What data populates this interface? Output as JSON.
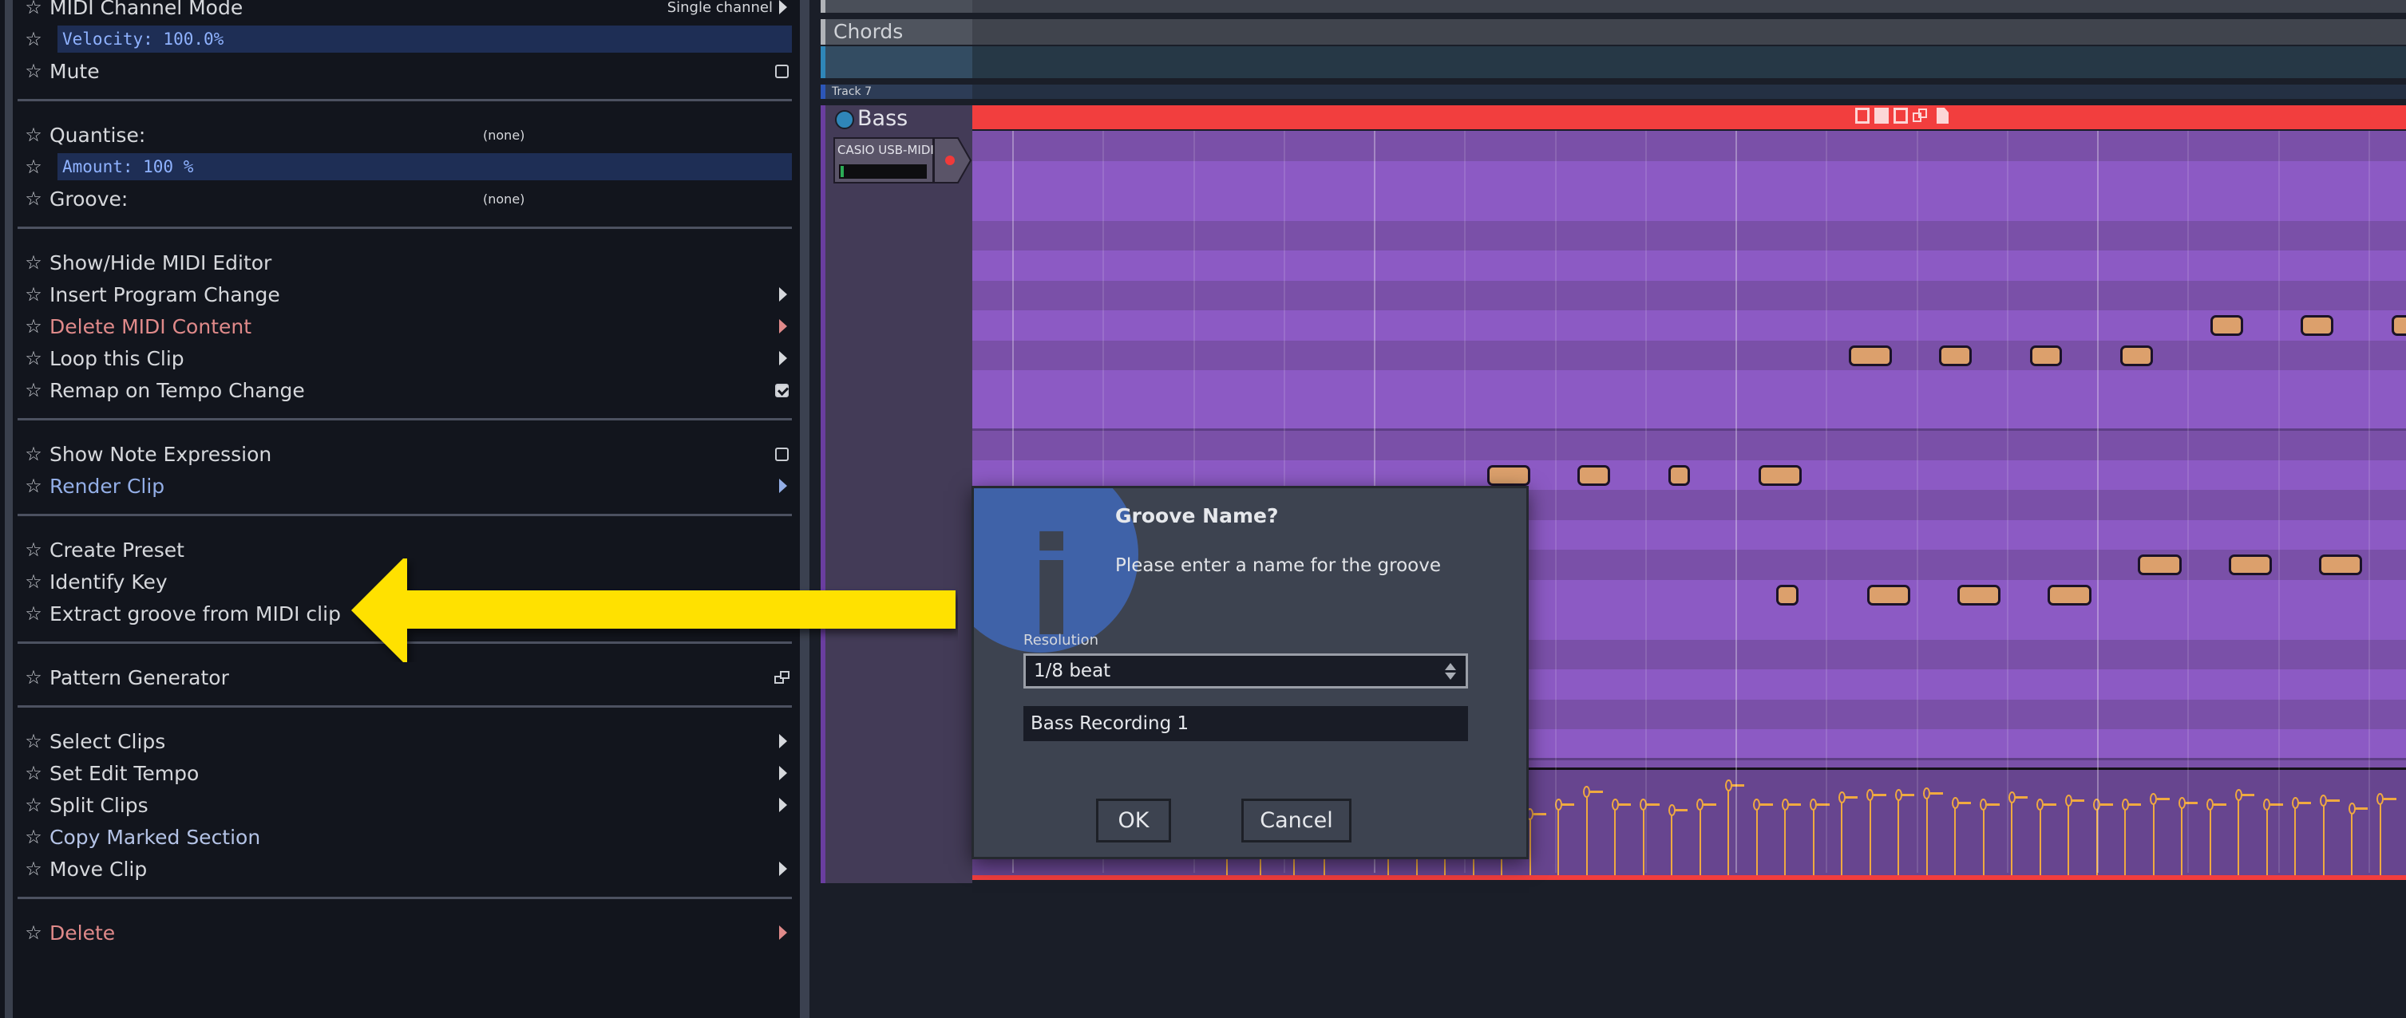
{
  "context_menu": {
    "items": [
      {
        "label": "MIDI Channel Mode",
        "value": "Single channel",
        "right": "submenu",
        "style": "normal"
      },
      {
        "label": "Velocity: 100.0%",
        "style": "slider"
      },
      {
        "label": "Mute",
        "right": "checkbox",
        "checked": false,
        "style": "normal"
      },
      {
        "label": "Quantise:",
        "value": "(none)",
        "style": "normal"
      },
      {
        "label": "Amount: 100 %",
        "style": "slider"
      },
      {
        "label": "Groove:",
        "value": "(none)",
        "style": "normal"
      },
      {
        "label": "Show/Hide MIDI Editor",
        "style": "normal"
      },
      {
        "label": "Insert Program Change",
        "right": "submenu",
        "style": "normal"
      },
      {
        "label": "Delete MIDI Content",
        "right": "submenu",
        "style": "red"
      },
      {
        "label": "Loop this Clip",
        "right": "submenu",
        "style": "normal"
      },
      {
        "label": "Remap on Tempo Change",
        "right": "checkbox",
        "checked": true,
        "style": "normal"
      },
      {
        "label": "Show Note Expression",
        "right": "checkbox",
        "checked": false,
        "style": "normal"
      },
      {
        "label": "Render Clip",
        "right": "submenu",
        "style": "blue"
      },
      {
        "label": "Create Preset",
        "style": "normal"
      },
      {
        "label": "Identify Key",
        "style": "normal"
      },
      {
        "label": "Extract groove from MIDI clip",
        "style": "normal"
      },
      {
        "label": "Pattern Generator",
        "right": "popout",
        "style": "normal"
      },
      {
        "label": "Select Clips",
        "right": "submenu",
        "style": "normal"
      },
      {
        "label": "Set Edit Tempo",
        "right": "submenu",
        "style": "normal"
      },
      {
        "label": "Split Clips",
        "right": "submenu",
        "style": "normal"
      },
      {
        "label": "Copy Marked Section",
        "style": "paleblue"
      },
      {
        "label": "Move Clip",
        "right": "submenu",
        "style": "normal"
      },
      {
        "label": "Delete",
        "right": "submenu",
        "style": "red"
      }
    ]
  },
  "tracks": {
    "chords": {
      "name": "Chords"
    },
    "track7": {
      "name": "Track 7"
    },
    "bass": {
      "name": "Bass",
      "input_device": "CASIO USB-MIDI",
      "record_armed": true
    }
  },
  "colors": {
    "clip_header": "#f23e3e",
    "midi_clip": "#8c5ac4",
    "note": "#dca06c",
    "velocity": "#f0a940",
    "annotation_arrow": "#ffe100",
    "dialog_icon": "#3f62a8"
  },
  "clip_toolbar_icons": [
    "square-outline-icon",
    "square-filled-icon",
    "corner-icon",
    "link-icon",
    "file-icon"
  ],
  "dialog": {
    "title": "Groove Name?",
    "message": "Please enter a name for the groove",
    "resolution_label": "Resolution",
    "resolution_value": "1/8 beat",
    "name_value": "Bass Recording 1",
    "ok_label": "OK",
    "cancel_label": "Cancel",
    "icon": "info-icon"
  },
  "annotation": {
    "type": "arrow",
    "points_to": "Extract groove from MIDI clip"
  },
  "piano_roll": {
    "notes": [
      {
        "beat": 1.7,
        "pitch_row": 11,
        "len": 0.2
      },
      {
        "beat": 2.2,
        "pitch_row": 11,
        "len": 0.15
      },
      {
        "beat": 2.7,
        "pitch_row": 11,
        "len": 0.1
      },
      {
        "beat": 3.2,
        "pitch_row": 11,
        "len": 0.2
      },
      {
        "beat": 3.7,
        "pitch_row": 7,
        "len": 0.2
      },
      {
        "beat": 4.2,
        "pitch_row": 7,
        "len": 0.15
      },
      {
        "beat": 4.7,
        "pitch_row": 7,
        "len": 0.15
      },
      {
        "beat": 5.2,
        "pitch_row": 7,
        "len": 0.15
      },
      {
        "beat": 5.7,
        "pitch_row": 6,
        "len": 0.15
      },
      {
        "beat": 6.2,
        "pitch_row": 6,
        "len": 0.15
      },
      {
        "beat": 6.7,
        "pitch_row": 6,
        "len": 0.1
      },
      {
        "beat": 1.05,
        "pitch_row": 16,
        "len": 0.2
      },
      {
        "beat": 1.55,
        "pitch_row": 16,
        "len": 0.2
      },
      {
        "beat": 1.05,
        "pitch_row": 15,
        "len": 0.2
      },
      {
        "beat": 3.3,
        "pitch_row": 15,
        "len": 0.1
      },
      {
        "beat": 3.8,
        "pitch_row": 15,
        "len": 0.2
      },
      {
        "beat": 4.3,
        "pitch_row": 15,
        "len": 0.2
      },
      {
        "beat": 4.8,
        "pitch_row": 15,
        "len": 0.2
      },
      {
        "beat": 5.3,
        "pitch_row": 14,
        "len": 0.2
      },
      {
        "beat": 5.8,
        "pitch_row": 14,
        "len": 0.2
      },
      {
        "beat": 6.3,
        "pitch_row": 14,
        "len": 0.2
      },
      {
        "beat": 6.85,
        "pitch_row": 14,
        "len": 0.2
      },
      {
        "beat": 0.3,
        "pitch_row": 17,
        "len": 0.2
      },
      {
        "beat": 0.8,
        "pitch_row": 17,
        "len": 0.2
      }
    ]
  }
}
